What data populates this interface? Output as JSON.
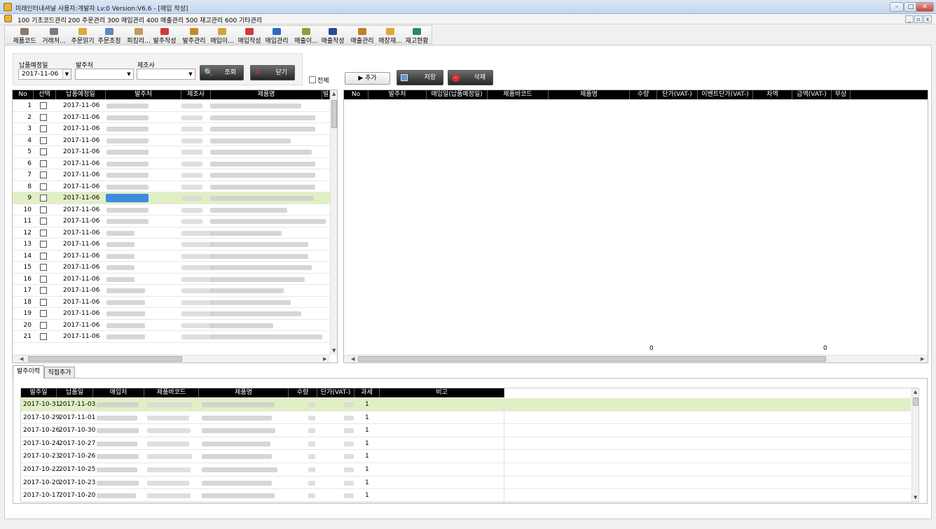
{
  "window": {
    "title": "미래인터내셔널 사용자:개발자 Lv:0  Version:V6.6 - [매입 작성]"
  },
  "menu": [
    "100 기초코드관리",
    "200 주문관리",
    "300 매입관리",
    "400 매출관리",
    "500 재고관리",
    "600 기타관리"
  ],
  "toolbar": [
    {
      "label": "제품코드",
      "icon": "product-code-icon",
      "color": "#8a7a6a"
    },
    {
      "label": "거래처...",
      "icon": "client-icon",
      "color": "#7a7a8a"
    },
    {
      "label": "주문읽기",
      "icon": "folder-icon",
      "color": "#e0a83a"
    },
    {
      "label": "주문조정",
      "icon": "adjust-icon",
      "color": "#5a8ac2"
    },
    {
      "label": "피킹리...",
      "icon": "picking-icon",
      "color": "#c29a5a"
    },
    {
      "label": "발주작성",
      "icon": "order-write-icon",
      "color": "#d23a3a"
    },
    {
      "label": "발주관리",
      "icon": "order-manage-icon",
      "color": "#c28a2a"
    },
    {
      "label": "매입이...",
      "icon": "purchase-history-icon",
      "color": "#d2a23a"
    },
    {
      "label": "매입작성",
      "icon": "purchase-write-icon",
      "color": "#d23a3a"
    },
    {
      "label": "매입관리",
      "icon": "purchase-manage-icon",
      "color": "#2a6ac2"
    },
    {
      "label": "매출이...",
      "icon": "sales-history-icon",
      "color": "#9a9a3a"
    },
    {
      "label": "매출작성",
      "icon": "sales-write-icon",
      "color": "#2a4a9a"
    },
    {
      "label": "매출관리",
      "icon": "sales-manage-icon",
      "color": "#c2802a"
    },
    {
      "label": "매장재...",
      "icon": "store-stock-icon",
      "color": "#e0a83a"
    },
    {
      "label": "재고현황",
      "icon": "stock-status-icon",
      "color": "#2a8a5a"
    }
  ],
  "filter": {
    "date_label": "납품예정일",
    "date_value": "2017-11-06",
    "supplier_label": "발주처",
    "supplier_value": "",
    "maker_label": "제조사",
    "maker_value": "",
    "search_label": "조회",
    "close_label": "닫기",
    "all_label": "전체"
  },
  "actions": {
    "add_label": "추가",
    "save_label": "저장",
    "delete_label": "삭제"
  },
  "left_grid": {
    "columns": [
      "No",
      "선택",
      "납품예정일",
      "발주처",
      "제조사",
      "제품명",
      "빌"
    ],
    "rows": [
      {
        "no": "1",
        "date": "2017-11-06",
        "checked": false
      },
      {
        "no": "2",
        "date": "2017-11-06",
        "checked": false
      },
      {
        "no": "3",
        "date": "2017-11-06",
        "checked": false
      },
      {
        "no": "4",
        "date": "2017-11-06",
        "checked": false
      },
      {
        "no": "5",
        "date": "2017-11-06",
        "checked": false
      },
      {
        "no": "6",
        "date": "2017-11-06",
        "checked": false
      },
      {
        "no": "7",
        "date": "2017-11-06",
        "checked": false
      },
      {
        "no": "8",
        "date": "2017-11-06",
        "checked": false
      },
      {
        "no": "9",
        "date": "2017-11-06",
        "checked": false,
        "selected": true
      },
      {
        "no": "10",
        "date": "2017-11-06",
        "checked": false
      },
      {
        "no": "11",
        "date": "2017-11-06",
        "checked": false
      },
      {
        "no": "12",
        "date": "2017-11-06",
        "checked": false
      },
      {
        "no": "13",
        "date": "2017-11-06",
        "checked": false
      },
      {
        "no": "14",
        "date": "2017-11-06",
        "checked": false
      },
      {
        "no": "15",
        "date": "2017-11-06",
        "checked": false
      },
      {
        "no": "16",
        "date": "2017-11-06",
        "checked": false
      },
      {
        "no": "17",
        "date": "2017-11-06",
        "checked": false
      },
      {
        "no": "18",
        "date": "2017-11-06",
        "checked": false
      },
      {
        "no": "19",
        "date": "2017-11-06",
        "checked": false
      },
      {
        "no": "20",
        "date": "2017-11-06",
        "checked": false
      },
      {
        "no": "21",
        "date": "2017-11-06",
        "checked": false
      }
    ]
  },
  "right_grid": {
    "columns": [
      "No",
      "발주처",
      "매입일(납품예정일)",
      "제품바코드",
      "제품명",
      "수량",
      "단가(VAT-)",
      "이벤트단가(VAT-)",
      "차액",
      "금액(VAT-)",
      "무상"
    ],
    "qty_total": "0",
    "amount_total": "0"
  },
  "tabs": [
    "발주이력",
    "직접추가"
  ],
  "history_grid": {
    "columns": [
      "발주일",
      "납품일",
      "매입처",
      "제품바코드",
      "제품명",
      "수량",
      "단가(VAT-)",
      "과세",
      "비고"
    ],
    "rows": [
      {
        "order_date": "2017-10-31",
        "delivery_date": "2017-11-03",
        "tax": "1",
        "selected": true
      },
      {
        "order_date": "2017-10-29",
        "delivery_date": "2017-11-01",
        "tax": "1"
      },
      {
        "order_date": "2017-10-26",
        "delivery_date": "2017-10-30",
        "tax": "1"
      },
      {
        "order_date": "2017-10-24",
        "delivery_date": "2017-10-27",
        "tax": "1"
      },
      {
        "order_date": "2017-10-23",
        "delivery_date": "2017-10-26",
        "tax": "1"
      },
      {
        "order_date": "2017-10-22",
        "delivery_date": "2017-10-25",
        "tax": "1"
      },
      {
        "order_date": "2017-10-20",
        "delivery_date": "2017-10-23",
        "tax": "1"
      },
      {
        "order_date": "2017-10-17",
        "delivery_date": "2017-10-20",
        "tax": "1"
      }
    ]
  },
  "colors": {
    "selected_row": "#e0f0c4",
    "header_bg": "#000000",
    "highlight": "#3e8be0"
  }
}
